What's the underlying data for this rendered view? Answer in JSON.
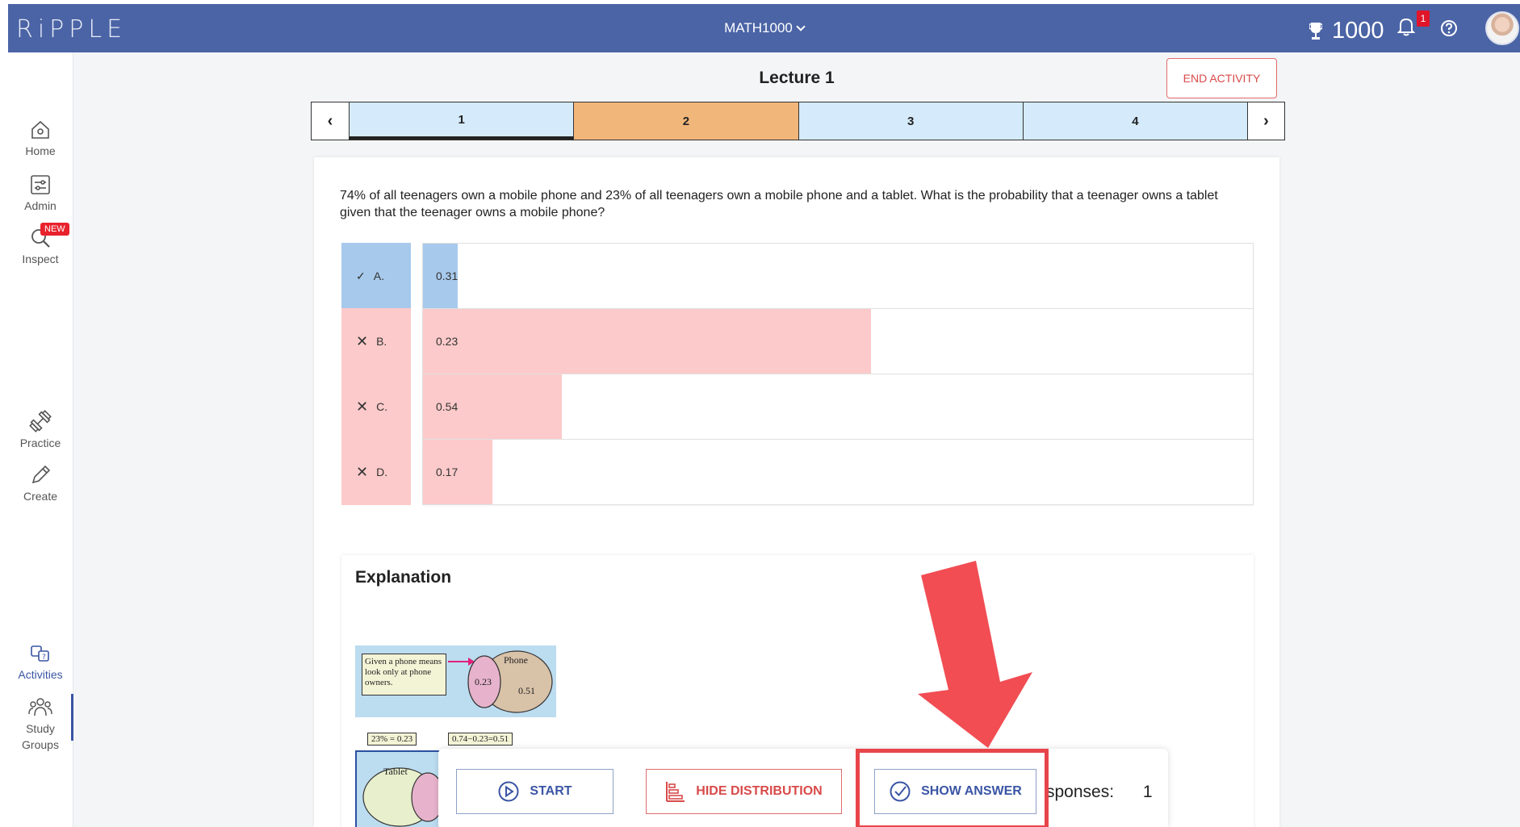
{
  "header": {
    "logo_text": "RiPPLE",
    "course": "MATH1000",
    "points": "1000",
    "notification_count": "1",
    "icons": [
      "trophy-icon",
      "bell-icon",
      "help-icon",
      "avatar"
    ]
  },
  "sidebar": {
    "items": [
      {
        "label": "Home",
        "icon": "home-icon"
      },
      {
        "label": "Admin",
        "icon": "admin-icon"
      },
      {
        "label": "Inspect",
        "icon": "inspect-icon",
        "badge": "NEW"
      },
      {
        "label": "Practice",
        "icon": "dumbbell-icon"
      },
      {
        "label": "Create",
        "icon": "pencil-icon"
      },
      {
        "label": "Activities",
        "icon": "activities-icon",
        "active": true
      },
      {
        "label": "Study Groups",
        "icon": "study-groups-icon"
      }
    ]
  },
  "activity": {
    "title": "Lecture 1",
    "end_label": "END ACTIVITY",
    "steps": [
      {
        "label": "1",
        "state": "done"
      },
      {
        "label": "2",
        "state": "current"
      },
      {
        "label": "3",
        "state": "pending"
      },
      {
        "label": "4",
        "state": "pending"
      }
    ],
    "question": "74% of all teenagers own a mobile phone and 23% of all teenagers own a mobile phone and a tablet. What is the probability that a teenager owns a tablet given that the teenager owns a mobile phone?",
    "options": [
      {
        "letter": "A.",
        "value": "0.31",
        "correct": true,
        "share": 0.042
      },
      {
        "letter": "B.",
        "value": "0.23",
        "correct": false,
        "share": 0.54
      },
      {
        "letter": "C.",
        "value": "0.54",
        "correct": false,
        "share": 0.167
      },
      {
        "letter": "D.",
        "value": "0.17",
        "correct": false,
        "share": 0.084
      }
    ],
    "explanation_title": "Explanation",
    "explanation_figure": {
      "note": "Given a phone means look only at phone owners.",
      "phone_label": "Phone",
      "both_value": "0.23",
      "phone_only": "0.51",
      "tag_1": "23% = 0.23",
      "tag_2": "0.74−0.23=0.51",
      "tablet_label": "Tablet"
    }
  },
  "controls": {
    "start_label": "START",
    "hide_distribution_label": "HIDE DISTRIBUTION",
    "show_answer_label": "SHOW ANSWER",
    "responses_label": "sponses:",
    "responses_count": "1"
  },
  "colors": {
    "header_bg": "#4b64a6",
    "correct": "#a7c9ec",
    "wrong": "#fccaca",
    "current_step": "#f1b67a",
    "pending_step": "#d5ebfb",
    "highlight": "#e8454b"
  }
}
